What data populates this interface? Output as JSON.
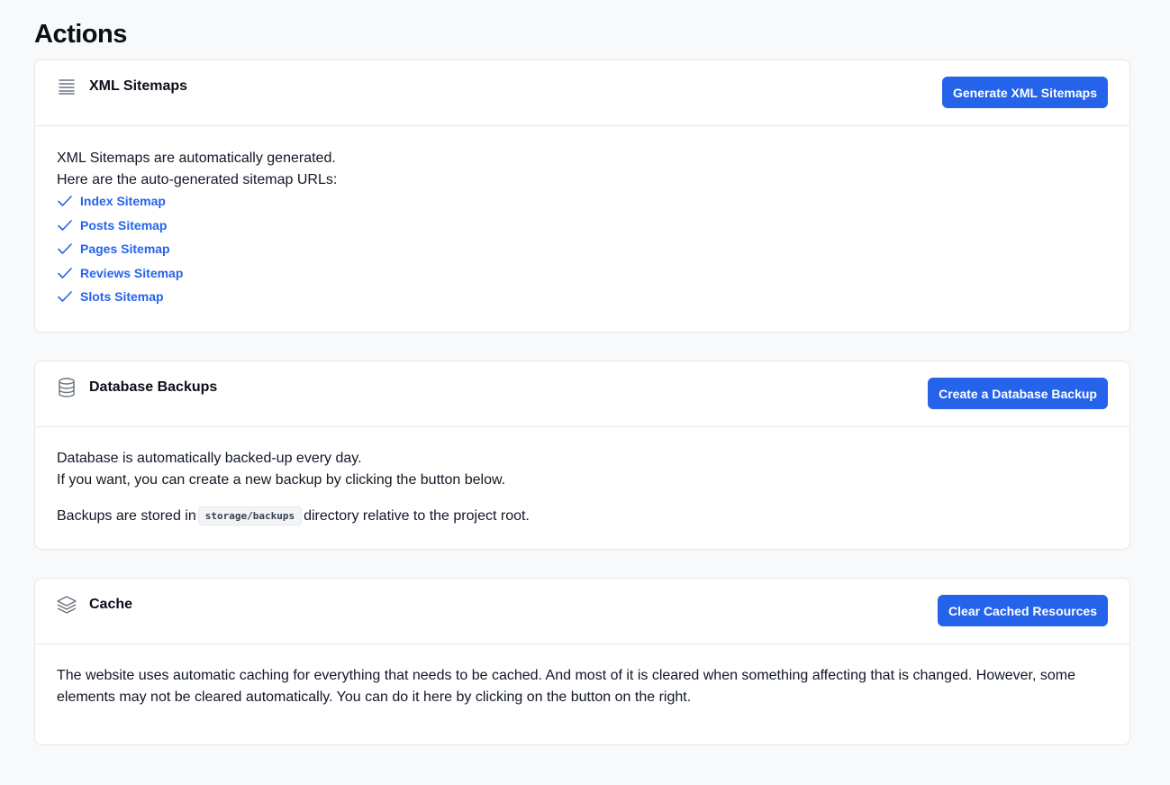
{
  "page": {
    "title": "Actions"
  },
  "sections": {
    "sitemaps": {
      "icon": "list-lines-icon",
      "title": "XML Sitemaps",
      "button": "Generate XML Sitemaps",
      "line1": "XML Sitemaps are automatically generated.",
      "line2": "Here are the auto-generated sitemap URLs:",
      "links": [
        {
          "label": "Index Sitemap",
          "icon": "check-icon"
        },
        {
          "label": "Posts Sitemap",
          "icon": "check-icon"
        },
        {
          "label": "Pages Sitemap",
          "icon": "check-icon"
        },
        {
          "label": "Reviews Sitemap",
          "icon": "check-icon"
        },
        {
          "label": "Slots Sitemap",
          "icon": "check-icon"
        }
      ]
    },
    "backups": {
      "icon": "database-icon",
      "title": "Database Backups",
      "button": "Create a Database Backup",
      "line1": "Database is automatically backed-up every day.",
      "line2": "If you want, you can create a new backup by clicking the button below.",
      "storage_prefix": "Backups are stored in",
      "storage_path": "storage/backups",
      "storage_suffix": "directory relative to the project root."
    },
    "cache": {
      "icon": "layers-icon",
      "title": "Cache",
      "button": "Clear Cached Resources",
      "text": "The website uses automatic caching for everything that needs to be cached. And most of it is cleared when something affecting that is changed. However, some elements may not be cleared automatically. You can do it here by clicking on the button on the right."
    }
  },
  "colors": {
    "accent": "#2563eb",
    "background": "#f8f9fb",
    "card": "#ffffff",
    "border": "#e5e7eb",
    "icon": "#6b7280"
  }
}
